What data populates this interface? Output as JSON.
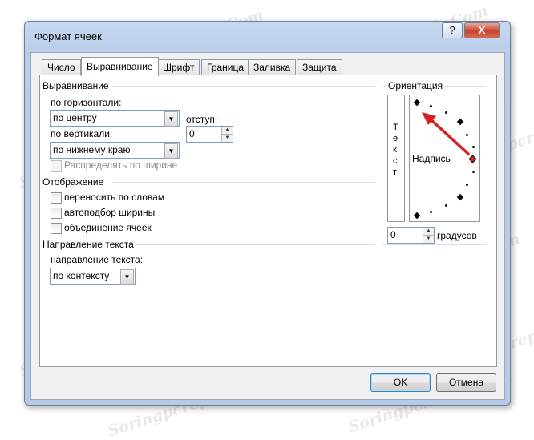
{
  "window": {
    "title": "Формат ячеек",
    "help_label": "?",
    "close_label": "X"
  },
  "tabs": [
    {
      "label": "Число"
    },
    {
      "label": "Выравнивание"
    },
    {
      "label": "Шрифт"
    },
    {
      "label": "Граница"
    },
    {
      "label": "Заливка"
    },
    {
      "label": "Защита"
    }
  ],
  "alignment": {
    "group_title": "Выравнивание",
    "horizontal_label": "по горизонтали:",
    "horizontal_value": "по центру",
    "vertical_label": "по вертикали:",
    "vertical_value": "по нижнему краю",
    "indent_label": "отступ:",
    "indent_value": "0",
    "distribute_label": "Распределять по ширине"
  },
  "display": {
    "group_title": "Отображение",
    "wrap_label": "переносить по словам",
    "shrink_label": "автоподбор ширины",
    "merge_label": "объединение ячеек"
  },
  "direction": {
    "group_title": "Направление текста",
    "text_direction_label": "направление текста:",
    "text_direction_value": "по контексту"
  },
  "orientation": {
    "group_title": "Ориентация",
    "vertical_text": "Т е к с т",
    "label": "Надпись",
    "degrees_value": "0",
    "degrees_label": "градусов"
  },
  "buttons": {
    "ok": "OK",
    "cancel": "Отмена"
  },
  "watermark": "Soringpcrepair.Com",
  "colors": {
    "arrow": "#d8201f",
    "active_point": "#e31f1f"
  }
}
